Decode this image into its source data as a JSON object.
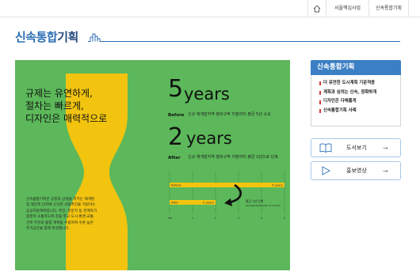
{
  "breadcrumb": {
    "items": [
      "서울핵심사업",
      "신속통합기획"
    ]
  },
  "page": {
    "title_part1": "신속통합",
    "title_part2": "기획"
  },
  "banner": {
    "slogan": [
      "규제는 유연하게,",
      "절차는 빠르게,",
      "디자인은 매력적으로"
    ],
    "intro": "신속통합기획은 공정과 상생을 지키는 재개발 및 재건축 단지에 신속한 사업추진을 지원하는 공공지원계획입니다. 주민, 전문가 등 관계자가 충분히 소통하도록 장을 열고 도시·환경·교통·건축 부문의 통합 계획을 수립하여 수준 높은 주거공간을 함께 완성합니다.",
    "before": {
      "number": "5",
      "unit": "years",
      "label": "Before",
      "text": "신규 재개발지역 정비구역 지정까지 평균 5년 소요"
    },
    "after": {
      "number": "2",
      "unit": "years",
      "label": "After",
      "text": "신규 재개발지역 정비구역 지정까지 평균 2년으로 단축"
    },
    "chart": {
      "axis_start": "year",
      "ticks": [
        "1",
        "2",
        "3",
        "4",
        "5"
      ],
      "before_row": {
        "label": "Before",
        "end": "5 years"
      },
      "after_row": {
        "label": "After",
        "end": "2 years"
      },
      "note_line1": "평균 2년 단축",
      "note_line2": "Average Reduction of 2 Years"
    }
  },
  "sidebar": {
    "heading": "신속통합기획",
    "items": [
      "더 유연한 도시계획 기준적용",
      "계획과 심의는 신속, 정확하게",
      "디자인은 다채롭게",
      "신속통합기획 사례"
    ]
  },
  "buttons": {
    "book": "도서보기",
    "video": "홍보영상"
  },
  "colors": {
    "panel": "#5cb85a",
    "hourglass": "#f2c40f",
    "accent": "#2d6fb4",
    "sidebar_header": "#3b7fc4",
    "marker": "#d63a3a"
  }
}
